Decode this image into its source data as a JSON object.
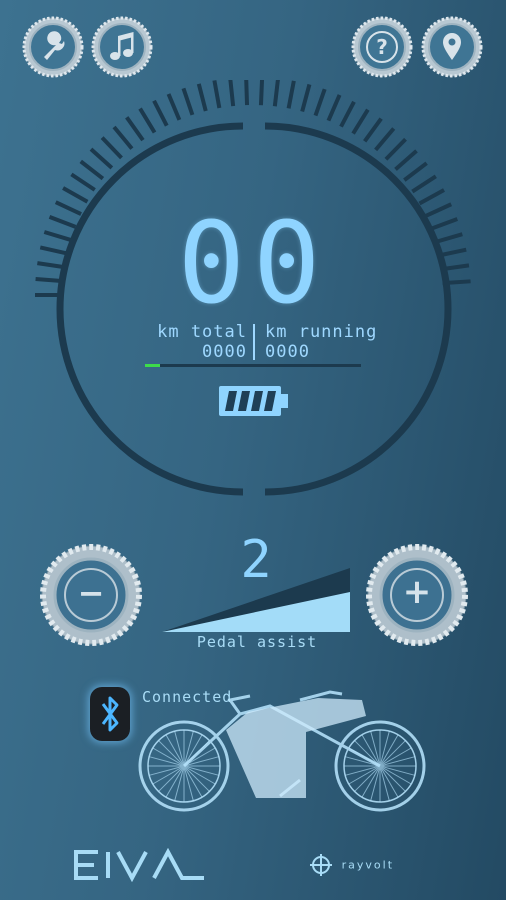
{
  "toolbar": {
    "settings_icon": "wrench-icon",
    "music_icon": "music-note-icon",
    "help_icon": "question-icon",
    "location_icon": "map-pin-icon"
  },
  "speedometer": {
    "speed": "00",
    "km_total_label": "km total",
    "km_total_value": "0000",
    "km_running_label": "km running",
    "km_running_value": "0000",
    "progress_fraction": 0.07,
    "battery_bars": 4,
    "battery_icon": "battery-icon"
  },
  "pedal_assist": {
    "level": "2",
    "label": "Pedal assist",
    "minus_label": "−",
    "plus_label": "+"
  },
  "connection": {
    "status": "Connected",
    "icon": "bluetooth-icon"
  },
  "footer": {
    "left_logo": "EIVA",
    "right_logo": "rayvolt"
  },
  "colors": {
    "accent": "#8fd4ff",
    "progress_fill": "#3ddc4a",
    "bluetooth_bg": "#1b1f24"
  }
}
